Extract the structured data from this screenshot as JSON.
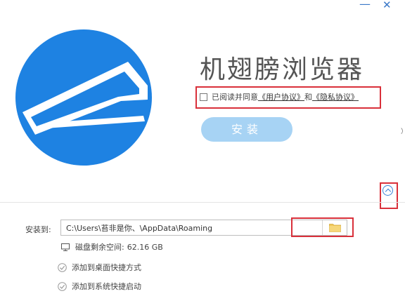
{
  "window": {
    "minimize_label": "—",
    "close_label": "✕"
  },
  "app": {
    "title": "机翅膀浏览器"
  },
  "agreement": {
    "prefix": "已阅读并同意",
    "user_agreement": "《用户协议》",
    "conjunction": "和",
    "privacy_policy": "《隐私协议》",
    "checked": false
  },
  "install_button": {
    "label": "安装"
  },
  "install_path": {
    "label": "安装到:",
    "value": "C:\\Users\\苔非是你、\\AppData\\Roaming"
  },
  "disk": {
    "label": "磁盘剩余空间:",
    "value": "62.16 GB"
  },
  "options": [
    {
      "label": "添加到桌面快捷方式",
      "checked": true
    },
    {
      "label": "添加到系统快捷启动",
      "checked": true
    }
  ],
  "colors": {
    "brand_blue": "#1e82e2",
    "install_button": "#a7d3f4",
    "highlight_red": "#d9303a",
    "folder_yellow": "#f0c75a"
  },
  "icons": {
    "logo": "wing-logo-icon",
    "collapse": "chevron-up-circle-icon",
    "browse": "folder-icon",
    "disk": "monitor-icon",
    "option": "check-circle-icon"
  },
  "edge_text": "）"
}
